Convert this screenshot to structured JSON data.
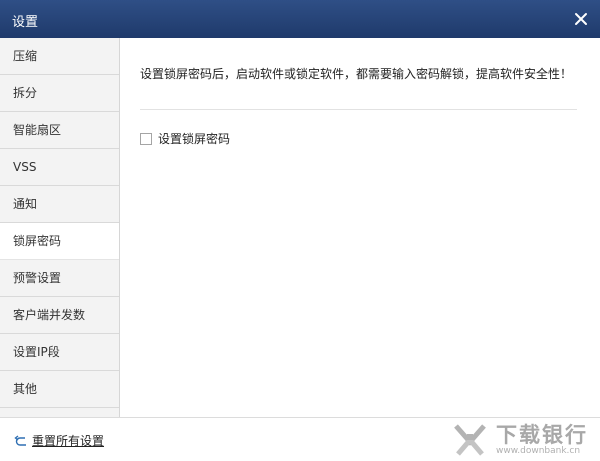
{
  "window": {
    "title": "设置"
  },
  "sidebar": {
    "items": [
      {
        "label": "压缩",
        "active": false
      },
      {
        "label": "拆分",
        "active": false
      },
      {
        "label": "智能扇区",
        "active": false
      },
      {
        "label": "VSS",
        "active": false
      },
      {
        "label": "通知",
        "active": false
      },
      {
        "label": "锁屏密码",
        "active": true
      },
      {
        "label": "预警设置",
        "active": false
      },
      {
        "label": "客户端并发数",
        "active": false
      },
      {
        "label": "设置IP段",
        "active": false
      },
      {
        "label": "其他",
        "active": false
      }
    ]
  },
  "content": {
    "description": "设置锁屏密码后，启动软件或锁定软件，都需要输入密码解锁，提高软件安全性！",
    "checkbox": {
      "label": "设置锁屏密码",
      "checked": false
    }
  },
  "footer": {
    "reset_label": "重置所有设置",
    "reset_icon": "undo-arrow-icon"
  },
  "watermark": {
    "brand": "下载银行",
    "url": "www.downbank.cn"
  },
  "colors": {
    "titlebar": "#1f3a6b",
    "sidebar_bg": "#f3f3f3",
    "active_bg": "#ffffff",
    "accent_icon": "#2f6fb3"
  }
}
